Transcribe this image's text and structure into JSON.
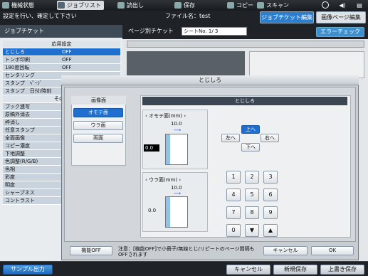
{
  "topbar": {
    "items": [
      {
        "label": "機械状態"
      },
      {
        "label": "ジョブリスト"
      },
      {
        "label": "読出し"
      },
      {
        "label": "保存"
      },
      {
        "label": "コピー"
      },
      {
        "label": "スキャン"
      }
    ]
  },
  "header": {
    "message": "設定を行い、確定して下さい",
    "file_name": "ファイル名：test",
    "tab_job_ticket": "ジョブチケット編集",
    "tab_page_edit": "画像ページ編集"
  },
  "left_panel": {
    "title": "ジョブチケット",
    "section_header": "応用設定",
    "rows": [
      {
        "label": "とじしろ",
        "value": "OFF"
      },
      {
        "label": "トンボ印刷",
        "value": "OFF"
      },
      {
        "label": "180度回転",
        "value": "OFF"
      },
      {
        "label": "センタリング",
        "value": ""
      },
      {
        "label": "スタンプ　ﾍﾟｰｼﾞ",
        "value": ""
      },
      {
        "label": "スタンプ　日付/時刻",
        "value": ""
      }
    ],
    "other_header": "その他",
    "other_rows": [
      {
        "label": "ブック連写"
      },
      {
        "label": "原稿外消去"
      },
      {
        "label": "枠消し"
      },
      {
        "label": "任意スタンプ"
      },
      {
        "label": "全面画像"
      },
      {
        "label": "コピー濃度"
      },
      {
        "label": "下地調整"
      },
      {
        "label": "色調整(R/G/B)"
      },
      {
        "label": "色相"
      },
      {
        "label": "彩度"
      },
      {
        "label": "明度"
      },
      {
        "label": "シャープネス"
      },
      {
        "label": "コントラスト"
      }
    ]
  },
  "center": {
    "page_ticket": "ページ別チケット",
    "sheet_no": "シートNo.",
    "sheet_value": "1/    3",
    "error_check": "エラーチェック"
  },
  "dialog": {
    "title": "とじしろ",
    "side_title": "画像面",
    "side_buttons": [
      {
        "label": "オモテ面",
        "selected": true
      },
      {
        "label": "ウラ面",
        "selected": false
      },
      {
        "label": "両面",
        "selected": false
      }
    ],
    "main_title": "とじしろ",
    "front": {
      "label": "オモテ面(mm)",
      "top_value": "10.0",
      "left_value": "0.0"
    },
    "back": {
      "label": "ウラ面(mm)",
      "top_value": "10.0",
      "left_value": "0.0"
    },
    "directions": {
      "up": "上へ",
      "left": "左へ",
      "right": "右へ",
      "down": "下へ"
    },
    "keypad": [
      "1",
      "2",
      "3",
      "4",
      "5",
      "6",
      "7",
      "8",
      "9",
      "0",
      "▼",
      "▲"
    ],
    "off_button": "機能OFF",
    "note": "注意：[機能OFF]で小冊子/無線とじ/リピートのページ間隔もOFFされます",
    "cancel": "キャンセル",
    "ok": "OK"
  },
  "bottom": {
    "sample": "サンプル出力",
    "cancel": "キャンセル",
    "save_new": "新規保存",
    "overwrite": "上書き保存"
  }
}
